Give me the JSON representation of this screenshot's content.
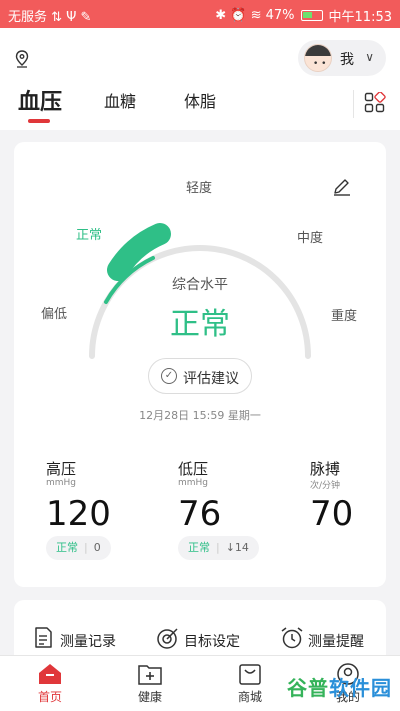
{
  "statusbar": {
    "carrier": "无服务 ⇅ Ψ ✎",
    "right": "✱ ⏰ ≋ 47%",
    "time": "中午11:53"
  },
  "header": {
    "location_icon": "location-pin-icon",
    "user_name": "我",
    "tabs": [
      {
        "label": "血压",
        "active": true
      },
      {
        "label": "血糖",
        "active": false
      },
      {
        "label": "体脂",
        "active": false
      }
    ]
  },
  "gauge": {
    "levels": [
      "偏低",
      "正常",
      "轻度",
      "中度",
      "重度"
    ],
    "current_level": "正常",
    "caption": "综合水平",
    "value_text": "正常",
    "advice_label": "评估建议",
    "timestamp": "12月28日 15:59 星期一"
  },
  "metrics": [
    {
      "name": "高压",
      "unit": "mmHg",
      "value": "120",
      "status": "正常",
      "count": "0"
    },
    {
      "name": "低压",
      "unit": "mmHg",
      "value": "76",
      "status": "正常",
      "count": "↓14"
    },
    {
      "name": "脉搏",
      "unit": "次/分钟",
      "value": "70"
    }
  ],
  "tools": [
    {
      "label": "测量记录",
      "icon": "record-icon"
    },
    {
      "label": "目标设定",
      "icon": "target-icon"
    },
    {
      "label": "测量提醒",
      "icon": "alarm-icon"
    }
  ],
  "tabbar": [
    {
      "label": "首页",
      "active": true
    },
    {
      "label": "健康",
      "active": false
    },
    {
      "label": "商城",
      "active": false
    },
    {
      "label": "我的",
      "active": false
    }
  ],
  "watermark": {
    "part1": "谷普",
    "part2": "软件园"
  },
  "colors": {
    "accent": "#e0373a",
    "normal_green": "#2fbf87",
    "status_bar": "#f25b5b"
  }
}
